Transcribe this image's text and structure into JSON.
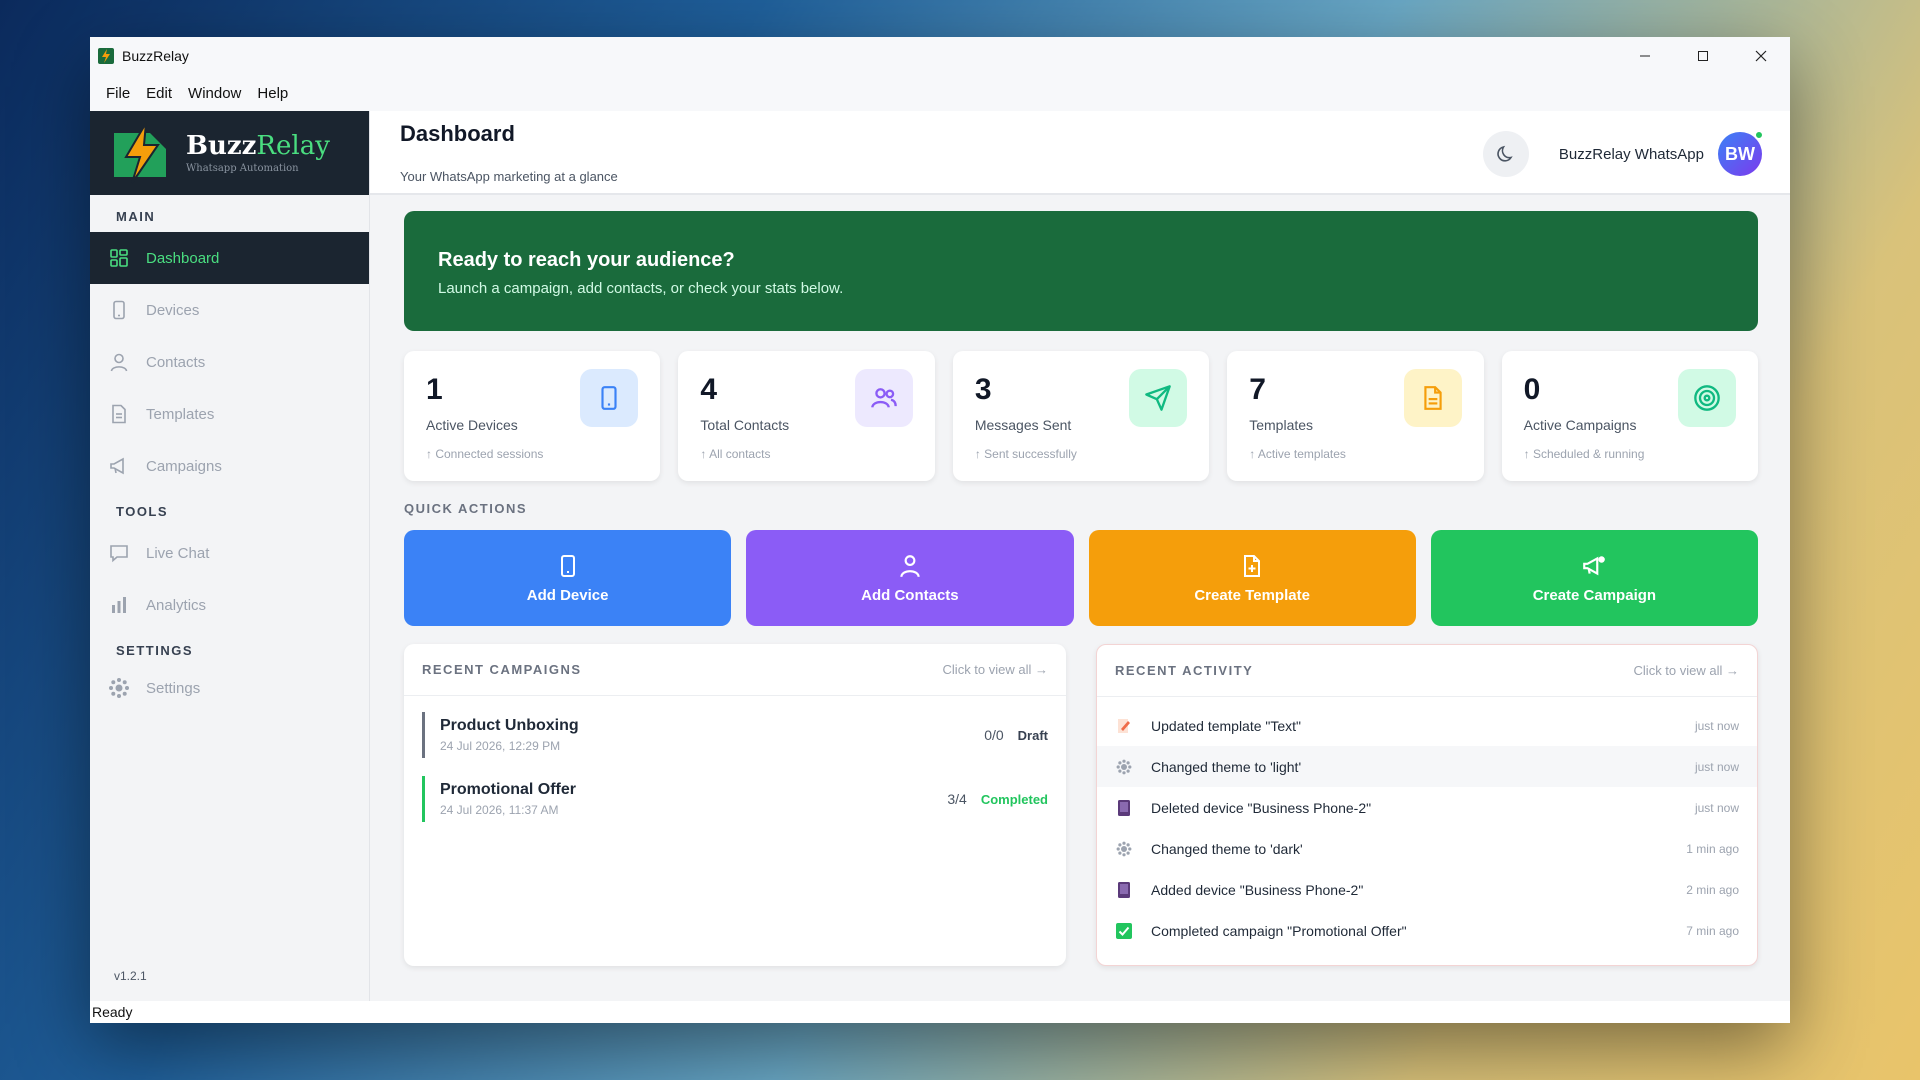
{
  "window": {
    "title": "BuzzRelay"
  },
  "menu": [
    "File",
    "Edit",
    "Window",
    "Help"
  ],
  "brand": {
    "name_main": "Buzz",
    "name_accent": "Relay",
    "subtitle": "Whatsapp Automation"
  },
  "sidebar": {
    "sections": {
      "main": "MAIN",
      "tools": "TOOLS",
      "settings": "SETTINGS"
    },
    "items": {
      "dashboard": "Dashboard",
      "devices": "Devices",
      "contacts": "Contacts",
      "templates": "Templates",
      "campaigns": "Campaigns",
      "live_chat": "Live Chat",
      "analytics": "Analytics",
      "settings": "Settings"
    },
    "version": "v1.2.1"
  },
  "header": {
    "title": "Dashboard",
    "subtitle": "Your WhatsApp marketing at a glance",
    "user_name": "BuzzRelay WhatsApp",
    "avatar_initials": "BW"
  },
  "banner": {
    "title": "Ready to reach your audience?",
    "subtitle": "Launch a campaign, add contacts, or check your stats below."
  },
  "stats": [
    {
      "value": "1",
      "label": "Active Devices",
      "sub": "↑ Connected sessions",
      "icon": "phone-icon",
      "color": "#3b82f6",
      "bg": "#dbeafe"
    },
    {
      "value": "4",
      "label": "Total Contacts",
      "sub": "↑ All contacts",
      "icon": "users-icon",
      "color": "#8b5cf6",
      "bg": "#ede9fe"
    },
    {
      "value": "3",
      "label": "Messages Sent",
      "sub": "↑ Sent successfully",
      "icon": "send-icon",
      "color": "#10b981",
      "bg": "#d1fae5"
    },
    {
      "value": "7",
      "label": "Templates",
      "sub": "↑ Active templates",
      "icon": "document-icon",
      "color": "#f59e0b",
      "bg": "#fef3c7"
    },
    {
      "value": "0",
      "label": "Active Campaigns",
      "sub": "↑ Scheduled & running",
      "icon": "target-icon",
      "color": "#10b981",
      "bg": "#d1fae5"
    }
  ],
  "quick_actions": {
    "label": "QUICK ACTIONS",
    "add_device": "Add Device",
    "add_contacts": "Add Contacts",
    "create_template": "Create Template",
    "create_campaign": "Create Campaign",
    "colors": {
      "blue": "#3b82f6",
      "purple": "#8b5cf6",
      "orange": "#f59e0b",
      "green": "#22c55e"
    }
  },
  "recent_campaigns": {
    "title": "RECENT CAMPAIGNS",
    "link": "Click to view all →",
    "items": [
      {
        "name": "Product Unboxing",
        "date": "24 Jul 2026, 12:29 PM",
        "count": "0/0",
        "status": "Draft"
      },
      {
        "name": "Promotional Offer",
        "date": "24 Jul 2026, 11:37 AM",
        "count": "3/4",
        "status": "Completed"
      }
    ]
  },
  "recent_activity": {
    "title": "RECENT ACTIVITY",
    "link": "Click to view all →",
    "items": [
      {
        "text": "Updated template \"Text\"",
        "time": "just now",
        "icon": "edit-document-icon"
      },
      {
        "text": "Changed theme to 'light'",
        "time": "just now",
        "icon": "gear-icon"
      },
      {
        "text": "Deleted device \"Business Phone-2\"",
        "time": "just now",
        "icon": "device-icon"
      },
      {
        "text": "Changed theme to 'dark'",
        "time": "1 min ago",
        "icon": "gear-icon"
      },
      {
        "text": "Added device \"Business Phone-2\"",
        "time": "2 min ago",
        "icon": "device-icon"
      },
      {
        "text": "Completed campaign \"Promotional Offer\"",
        "time": "7 min ago",
        "icon": "check-icon"
      }
    ]
  },
  "statusbar": {
    "text": "Ready"
  }
}
